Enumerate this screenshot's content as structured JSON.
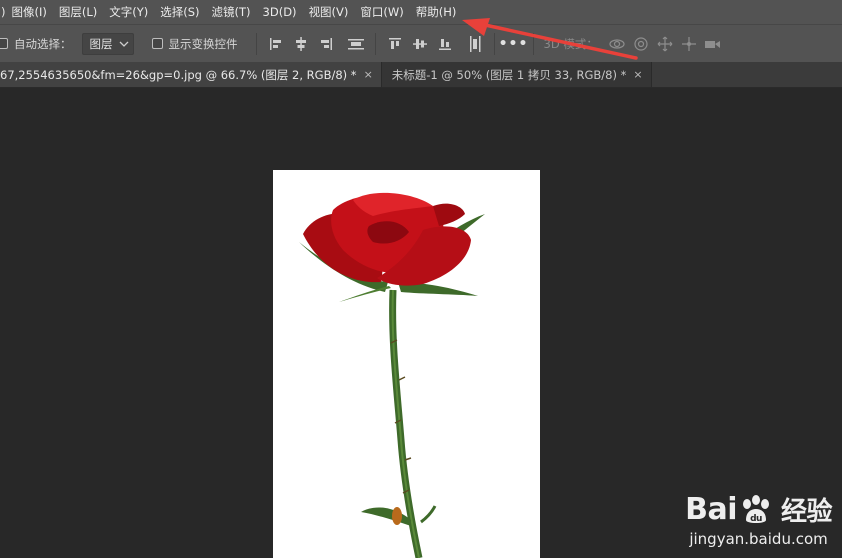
{
  "menubar": {
    "left_fragment": ")",
    "items": [
      "图像(I)",
      "图层(L)",
      "文字(Y)",
      "选择(S)",
      "滤镜(T)",
      "3D(D)",
      "视图(V)",
      "窗口(W)",
      "帮助(H)"
    ]
  },
  "options": {
    "auto_select_label": "自动选择：",
    "auto_select_value": "图层",
    "show_transform_label": "显示变换控件",
    "mode_3d_label": "3D 模式："
  },
  "tabs": [
    {
      "label": "67,2554635650&fm=26&gp=0.jpg @ 66.7% (图层 2, RGB/8) *",
      "close": "×",
      "active": true
    },
    {
      "label": "未标题-1 @ 50% (图层 1 拷贝 33, RGB/8) *",
      "close": "×",
      "active": false
    }
  ],
  "watermark": {
    "brand": "Bai",
    "brand_suffix": "经验",
    "url": "jingyan.baidu.com"
  },
  "colors": {
    "arrow": "#e8413a",
    "menubar_bg": "#535353",
    "canvas_bg": "#282828"
  }
}
